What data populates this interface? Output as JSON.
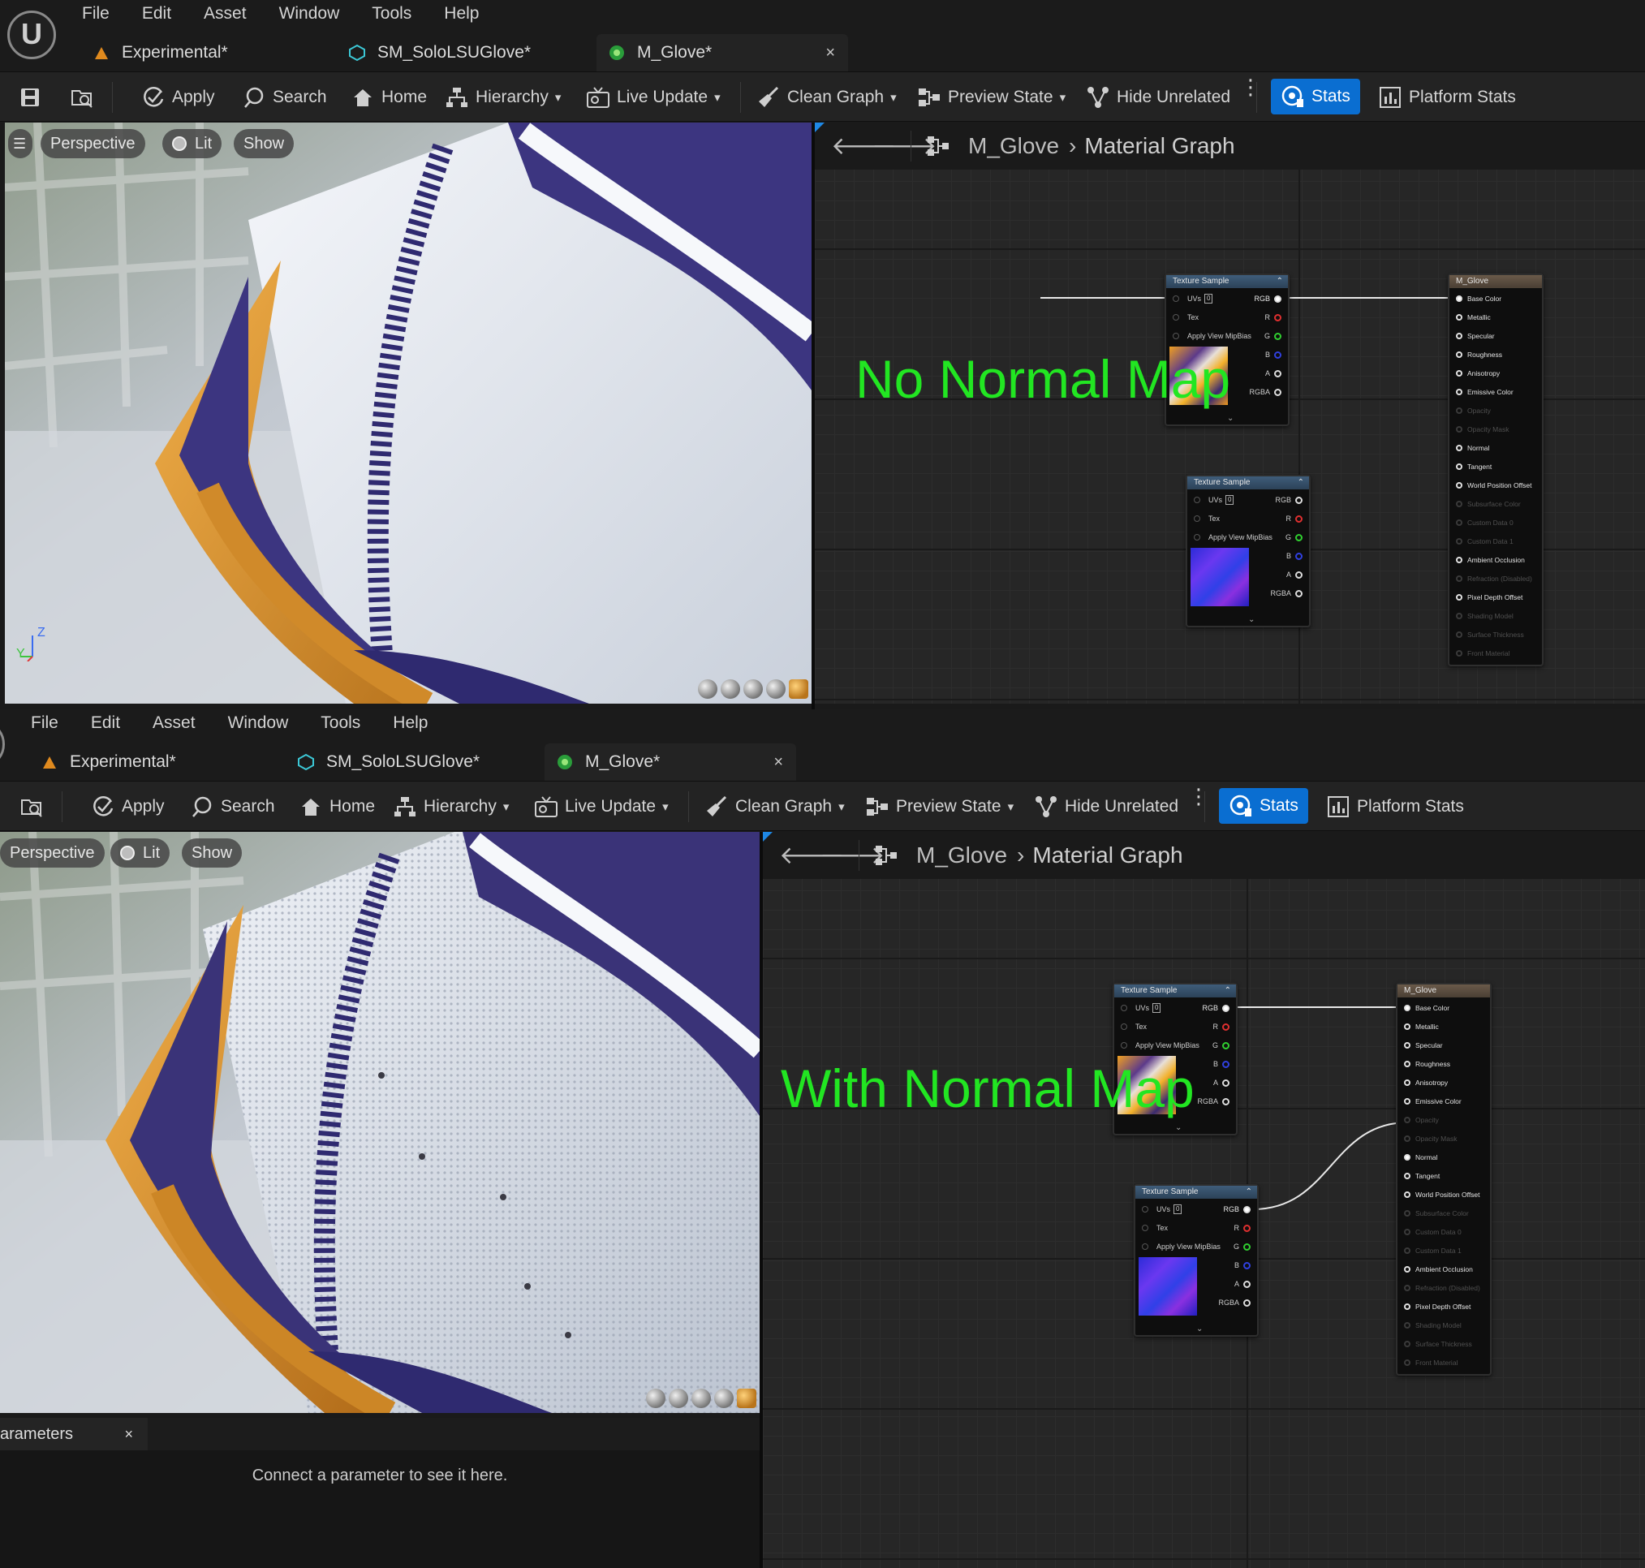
{
  "menu": [
    "File",
    "Edit",
    "Asset",
    "Window",
    "Tools",
    "Help"
  ],
  "tabs": [
    {
      "label": "Experimental*",
      "icon": "experimental-icon"
    },
    {
      "label": "SM_SoloLSUGlove*",
      "icon": "static-mesh-icon"
    },
    {
      "label": "M_Glove*",
      "icon": "material-icon",
      "active": true
    }
  ],
  "toolbar": {
    "apply": "Apply",
    "search": "Search",
    "home": "Home",
    "hierarchy": "Hierarchy",
    "live_update": "Live Update",
    "clean_graph": "Clean Graph",
    "preview_state": "Preview State",
    "hide_unrelated": "Hide Unrelated",
    "stats": "Stats",
    "platform_stats": "Platform Stats"
  },
  "viewport": {
    "perspective": "Perspective",
    "lit": "Lit",
    "show": "Show",
    "axis_z": "Z",
    "axis_y": "Y"
  },
  "graph": {
    "breadcrumb_material": "M_Glove",
    "breadcrumb_graph": "Material Graph"
  },
  "texture_node": {
    "title": "Texture Sample",
    "inputs": [
      "UVs",
      "Tex",
      "Apply View MipBias"
    ],
    "uv_index": "0",
    "outputs": [
      "RGB",
      "R",
      "G",
      "B",
      "A",
      "RGBA"
    ]
  },
  "result_node": {
    "title": "M_Glove",
    "pins": [
      {
        "label": "Base Color",
        "enabled": true
      },
      {
        "label": "Metallic",
        "enabled": true
      },
      {
        "label": "Specular",
        "enabled": true
      },
      {
        "label": "Roughness",
        "enabled": true
      },
      {
        "label": "Anisotropy",
        "enabled": true
      },
      {
        "label": "Emissive Color",
        "enabled": true
      },
      {
        "label": "Opacity",
        "enabled": false
      },
      {
        "label": "Opacity Mask",
        "enabled": false
      },
      {
        "label": "Normal",
        "enabled": true
      },
      {
        "label": "Tangent",
        "enabled": true
      },
      {
        "label": "World Position Offset",
        "enabled": true
      },
      {
        "label": "Subsurface Color",
        "enabled": false
      },
      {
        "label": "Custom Data 0",
        "enabled": false
      },
      {
        "label": "Custom Data 1",
        "enabled": false
      },
      {
        "label": "Ambient Occlusion",
        "enabled": true
      },
      {
        "label": "Refraction (Disabled)",
        "enabled": false
      },
      {
        "label": "Pixel Depth Offset",
        "enabled": true
      },
      {
        "label": "Shading Model",
        "enabled": false
      },
      {
        "label": "Surface Thickness",
        "enabled": false
      },
      {
        "label": "Front Material",
        "enabled": false
      }
    ]
  },
  "labels": {
    "top": "No Normal Map",
    "bottom": "With Normal Map"
  },
  "parameters": {
    "tab": "arameters",
    "close": "×",
    "empty_message": "Connect a parameter to see it here."
  },
  "colors": {
    "accent": "#0a6ed1",
    "label_green": "#22e622",
    "glove_orange": "#d9962f",
    "glove_purple": "#3c3580",
    "glove_white": "#e4e8ef"
  }
}
